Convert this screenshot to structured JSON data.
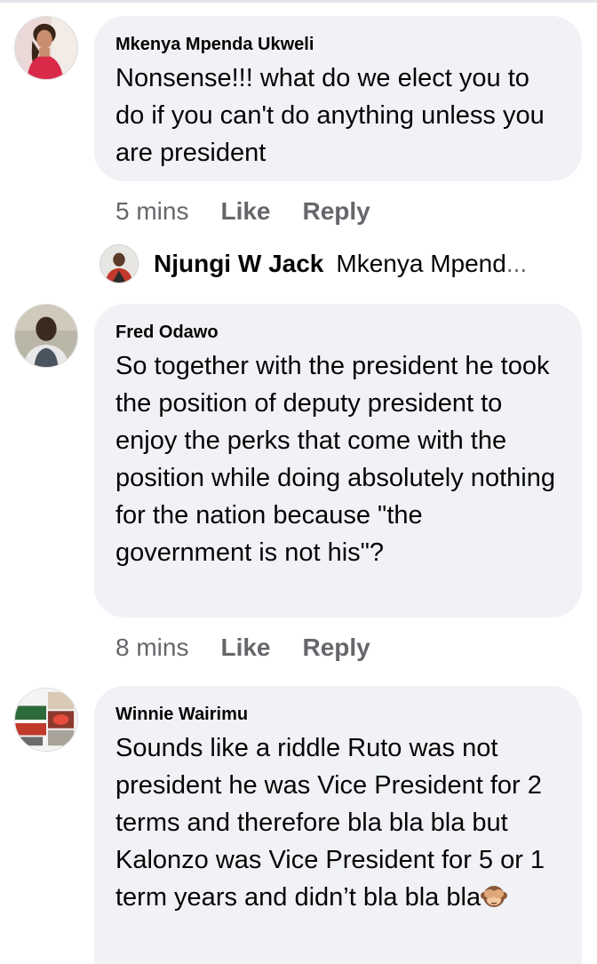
{
  "comments": [
    {
      "author": "Mkenya Mpenda Ukweli",
      "text": "Nonsense!!! what do we elect you to do if you can't do anything unless you are president",
      "time": "5 mins",
      "like_label": "Like",
      "reply_label": "Reply"
    },
    {
      "author": "Fred Odawo",
      "text": "So together with the president he took the position of deputy president to enjoy the perks that come with the position while doing absolutely nothing for the nation because \"the government is not his\"?",
      "time": "8 mins",
      "like_label": "Like",
      "reply_label": "Reply"
    },
    {
      "author": "Winnie Wairimu",
      "text": "Sounds like a riddle Ruto was not president he was Vice President for 2 terms and therefore bla bla bla but Kalonzo was Vice President for 5 or 1 term years and didn’t bla bla bla",
      "emoji": "see-no-evil-monkey",
      "time": "",
      "like_label": "",
      "reply_label": ""
    }
  ],
  "reply": {
    "author": "Njungi W Jack",
    "preview": "Mkenya Mpend",
    "ellipsis": "..."
  },
  "colors": {
    "bubble": "#f0f2f5",
    "meta_text": "#65676b",
    "body_text": "#050505"
  }
}
